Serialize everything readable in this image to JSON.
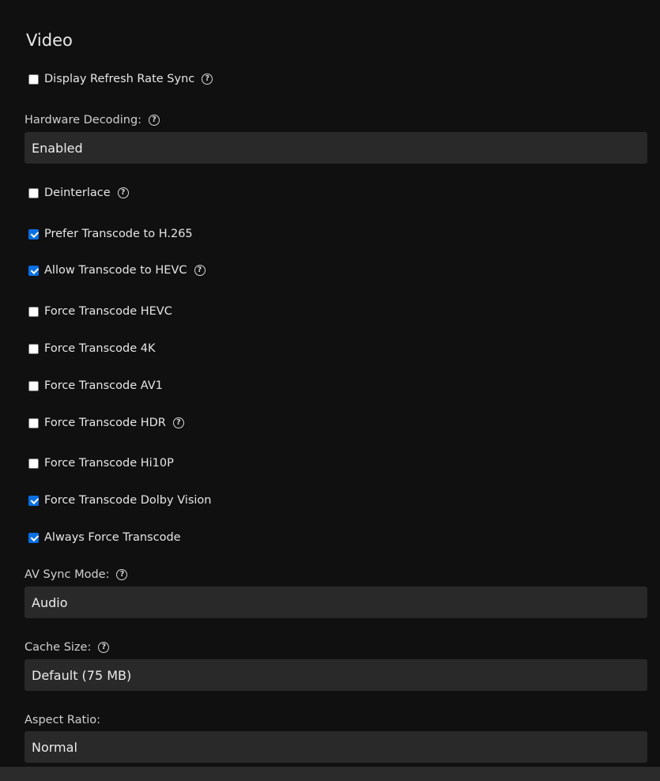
{
  "section": {
    "title": "Video"
  },
  "options": {
    "display_refresh_rate_sync": {
      "label": "Display Refresh Rate Sync",
      "checked": false,
      "help": true
    },
    "deinterlace": {
      "label": "Deinterlace",
      "checked": false,
      "help": true
    },
    "prefer_transcode_h265": {
      "label": "Prefer Transcode to H.265",
      "checked": true,
      "help": false
    },
    "allow_transcode_hevc": {
      "label": "Allow Transcode to HEVC",
      "checked": true,
      "help": true
    },
    "force_transcode_hevc": {
      "label": "Force Transcode HEVC",
      "checked": false,
      "help": false
    },
    "force_transcode_4k": {
      "label": "Force Transcode 4K",
      "checked": false,
      "help": false
    },
    "force_transcode_av1": {
      "label": "Force Transcode AV1",
      "checked": false,
      "help": false
    },
    "force_transcode_hdr": {
      "label": "Force Transcode HDR",
      "checked": false,
      "help": true
    },
    "force_transcode_hi10p": {
      "label": "Force Transcode Hi10P",
      "checked": false,
      "help": false
    },
    "force_transcode_dolby_vision": {
      "label": "Force Transcode Dolby Vision",
      "checked": true,
      "help": false
    },
    "always_force_transcode": {
      "label": "Always Force Transcode",
      "checked": true,
      "help": false
    }
  },
  "selects": {
    "hardware_decoding": {
      "label": "Hardware Decoding:",
      "value": "Enabled",
      "help": true
    },
    "av_sync_mode": {
      "label": "AV Sync Mode:",
      "value": "Audio",
      "help": true
    },
    "cache_size": {
      "label": "Cache Size:",
      "value": "Default (75 MB)",
      "help": true
    },
    "aspect_ratio": {
      "label": "Aspect Ratio:",
      "value": "Normal",
      "help": false
    }
  },
  "icons": {
    "help": "question-circle-icon",
    "help_glyph": "?"
  },
  "colors": {
    "background": "#101010",
    "field_background": "#292929",
    "checkbox_accent": "#0a6fe3",
    "text": "#e6e6e6"
  }
}
